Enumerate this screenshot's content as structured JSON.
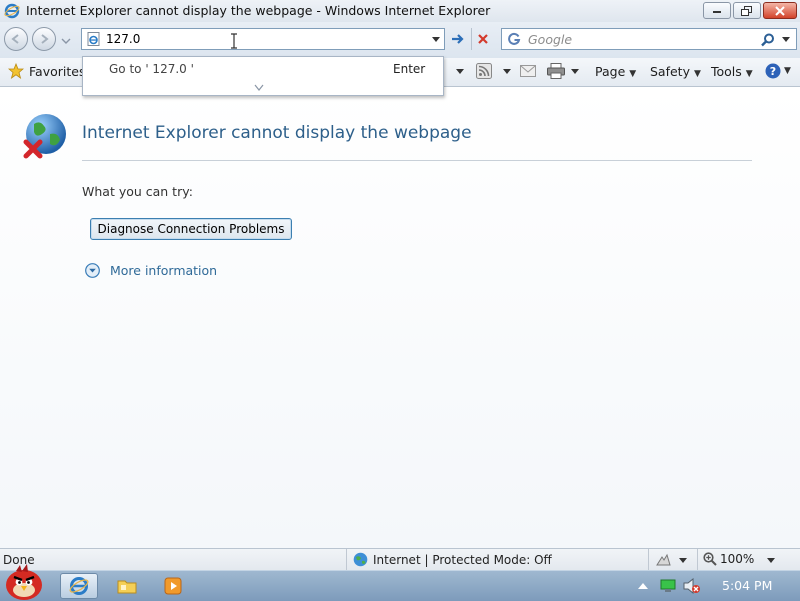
{
  "window": {
    "title": "Internet Explorer cannot display the webpage - Windows Internet Explorer"
  },
  "address": {
    "value": "127.0",
    "search_placeholder": "Google"
  },
  "autocomplete": {
    "goto_label": "Go to ' 127.0 '",
    "enter_label": "Enter"
  },
  "commandbar": {
    "favorites": "Favorites",
    "page": "Page",
    "safety": "Safety",
    "tools": "Tools"
  },
  "content": {
    "heading": "Internet Explorer cannot display the webpage",
    "try_label": "What you can try:",
    "diagnose_button": "Diagnose Connection Problems",
    "more_info": "More information"
  },
  "statusbar": {
    "status": "Done",
    "zone": "Internet | Protected Mode: Off",
    "zoom": "100%"
  },
  "taskbar": {
    "clock": "5:04 PM"
  },
  "colors": {
    "heading": "#2d5f8a",
    "link": "#2f6a98",
    "accent_blue": "#3a86c8",
    "stop_red": "#d33a2c"
  }
}
